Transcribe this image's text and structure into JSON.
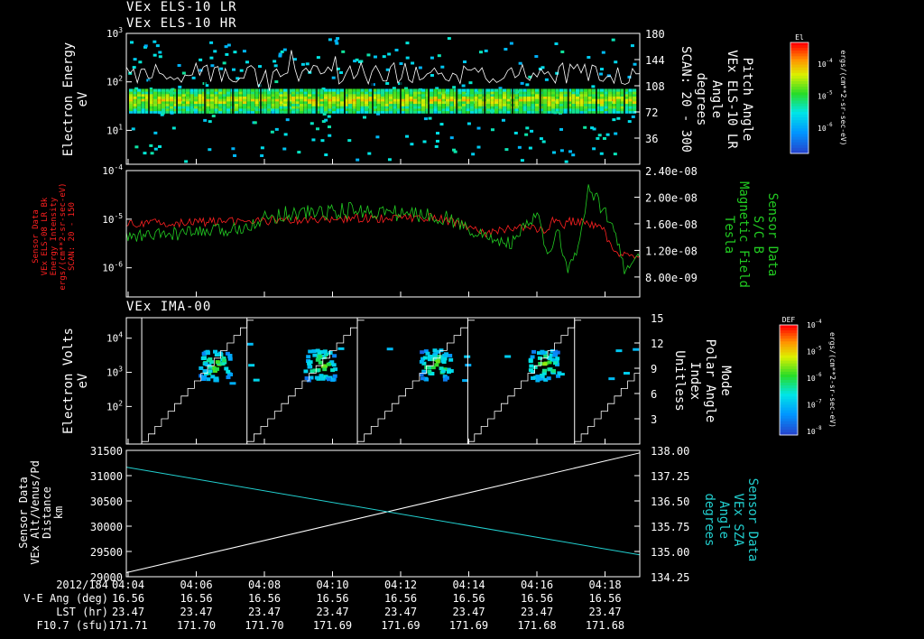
{
  "titles": {
    "line1": "VEx ELS-10 LR",
    "line2": "VEx ELS-10 HR",
    "ima_title": "VEx IMA-00"
  },
  "colors": {
    "background": "#000000",
    "foreground": "#ffffff",
    "red_trace": "#ff2020",
    "green_trace": "#22cc22",
    "cyan_trace": "#22d0d0",
    "white_trace": "#ffffff"
  },
  "chart_data": [
    {
      "id": "els",
      "type": "heatmap",
      "left_label_lines": [
        "Electron Energy",
        "eV"
      ],
      "right_label_lines": [
        "Pitch Angle",
        "VEx ELS-10 LR",
        "Angle",
        "degrees",
        "SCAN: 20 - 300"
      ],
      "y_ticks": [
        "10^3",
        "10^2",
        "10^1"
      ],
      "y_log_range": [
        0.3,
        3
      ],
      "right_ticks": [
        "180",
        "144",
        "108",
        "72",
        "36"
      ],
      "right_range": [
        0,
        180
      ],
      "colorbar": {
        "title": "El",
        "units": "ergs/(cm**2-sr-sec-eV)",
        "ticks": [
          "10^-4",
          "10^-5",
          "10^-6"
        ],
        "tick_pos": [
          0.2,
          0.5,
          0.8
        ]
      },
      "band_log_energy": [
        1.35,
        1.85
      ],
      "overlay_pitch_mean_deg": 125
    },
    {
      "id": "timeseries",
      "type": "line",
      "y_ticks": [
        "10^-4",
        "10^-5",
        "10^-6"
      ],
      "y_log_range": [
        -6.6,
        -4
      ],
      "right_ticks": [
        "2.40e-08",
        "2.00e-08",
        "1.60e-08",
        "1.20e-08",
        "8.00e-09"
      ],
      "right_range": [
        5e-09,
        2.4e-08
      ],
      "left_label_lines": [
        "Sensor Data",
        "VEx ELS-08 LR Bk",
        "Energy Intensity",
        "ergs/(cm**2-sr-sec-eV)",
        "SCAN: 20 - 150"
      ],
      "right_label_lines": [
        "Sensor Data",
        "S/C B",
        "Magnetic Field",
        "Tesla"
      ],
      "series": [
        {
          "name": "Energy Intensity",
          "color": "red",
          "knots_t": [
            0,
            0.3,
            0.6,
            0.65,
            0.7,
            0.75,
            0.82,
            0.83,
            0.85,
            0.86,
            0.9,
            0.93,
            0.95,
            1
          ],
          "knots_v": [
            1.6e-08,
            1.65e-08,
            1.7e-08,
            1.6e-08,
            1.45e-08,
            1.55e-08,
            1.5e-08,
            1.7e-08,
            1.55e-08,
            1.65e-08,
            1.6e-08,
            1.5e-08,
            1.15e-08,
            1.1e-08
          ]
        },
        {
          "name": "Magnetic Field",
          "color": "green",
          "knots_t": [
            0,
            0.2,
            0.3,
            0.45,
            0.55,
            0.62,
            0.7,
            0.75,
            0.8,
            0.82,
            0.84,
            0.86,
            0.88,
            0.9,
            0.93,
            0.95,
            0.97,
            1
          ],
          "knots_v": [
            1.4e-08,
            1.5e-08,
            1.75e-08,
            1.8e-08,
            1.75e-08,
            1.7e-08,
            1.4e-08,
            1.3e-08,
            1.75e-08,
            1.1e-08,
            1.5e-08,
            9e-09,
            1.2e-08,
            2.1e-08,
            1.8e-08,
            1.6e-08,
            9e-09,
            1.1e-08
          ]
        }
      ]
    },
    {
      "id": "ima",
      "type": "heatmap",
      "title": "VEx IMA-00",
      "left_label_lines": [
        "Electron Volts",
        "eV"
      ],
      "right_label_lines": [
        "Mode",
        "Polar Angle",
        "Index",
        "Unitless"
      ],
      "y_ticks": [
        "10^4",
        "10^3",
        "10^2"
      ],
      "y_log_range": [
        0.9,
        4.6
      ],
      "right_ticks": [
        "15",
        "12",
        "9",
        "6",
        "3"
      ],
      "right_range": [
        0,
        15
      ],
      "colorbar": {
        "title": "DEF",
        "units": "ergs/(cm**2-sr-sec-eV)",
        "ticks": [
          "10^-4",
          "10^-5",
          "10^-6",
          "10^-7",
          "10^-8"
        ],
        "tick_pos": [
          0.0,
          0.25,
          0.5,
          0.75,
          1.0
        ]
      },
      "scan_boundaries_t": [
        0.03,
        0.235,
        0.45,
        0.665,
        0.873
      ],
      "clusters_t": [
        0.17,
        0.375,
        0.6,
        0.81
      ],
      "cluster_log_energy": 3.25
    },
    {
      "id": "distance",
      "type": "line",
      "left_label_lines": [
        "Sensor Data",
        "VEx Alt/Venus/Pd",
        "Distance",
        "km"
      ],
      "right_label_lines": [
        "Sensor Data",
        "VEx SZA",
        "Angle",
        "degrees"
      ],
      "y_ticks": [
        "31500",
        "31000",
        "30500",
        "30000",
        "29500",
        "29000"
      ],
      "y_range": [
        29000,
        31500
      ],
      "right_ticks": [
        "138.00",
        "137.25",
        "136.50",
        "135.75",
        "135.00",
        "134.25"
      ],
      "right_range": [
        134.25,
        138
      ],
      "series": [
        {
          "name": "Alt",
          "color": "white",
          "t": [
            0,
            1
          ],
          "y": [
            29080,
            31450
          ]
        },
        {
          "name": "SZA",
          "color": "cyan",
          "t": [
            0,
            1
          ],
          "y": [
            137.5,
            134.9
          ]
        }
      ]
    }
  ],
  "time_axis": {
    "row_labels": [
      "2012/184",
      "V-E Ang (deg)",
      "LST (hr)",
      "F10.7 (sfu)"
    ],
    "columns": [
      {
        "time": "04:04",
        "ve": "16.56",
        "lst": "23.47",
        "f107": "171.71"
      },
      {
        "time": "04:06",
        "ve": "16.56",
        "lst": "23.47",
        "f107": "171.70"
      },
      {
        "time": "04:08",
        "ve": "16.56",
        "lst": "23.47",
        "f107": "171.70"
      },
      {
        "time": "04:10",
        "ve": "16.56",
        "lst": "23.47",
        "f107": "171.69"
      },
      {
        "time": "04:12",
        "ve": "16.56",
        "lst": "23.47",
        "f107": "171.69"
      },
      {
        "time": "04:14",
        "ve": "16.56",
        "lst": "23.47",
        "f107": "171.69"
      },
      {
        "time": "04:16",
        "ve": "16.56",
        "lst": "23.47",
        "f107": "171.68"
      },
      {
        "time": "04:18",
        "ve": "16.56",
        "lst": "23.47",
        "f107": "171.68"
      }
    ]
  }
}
